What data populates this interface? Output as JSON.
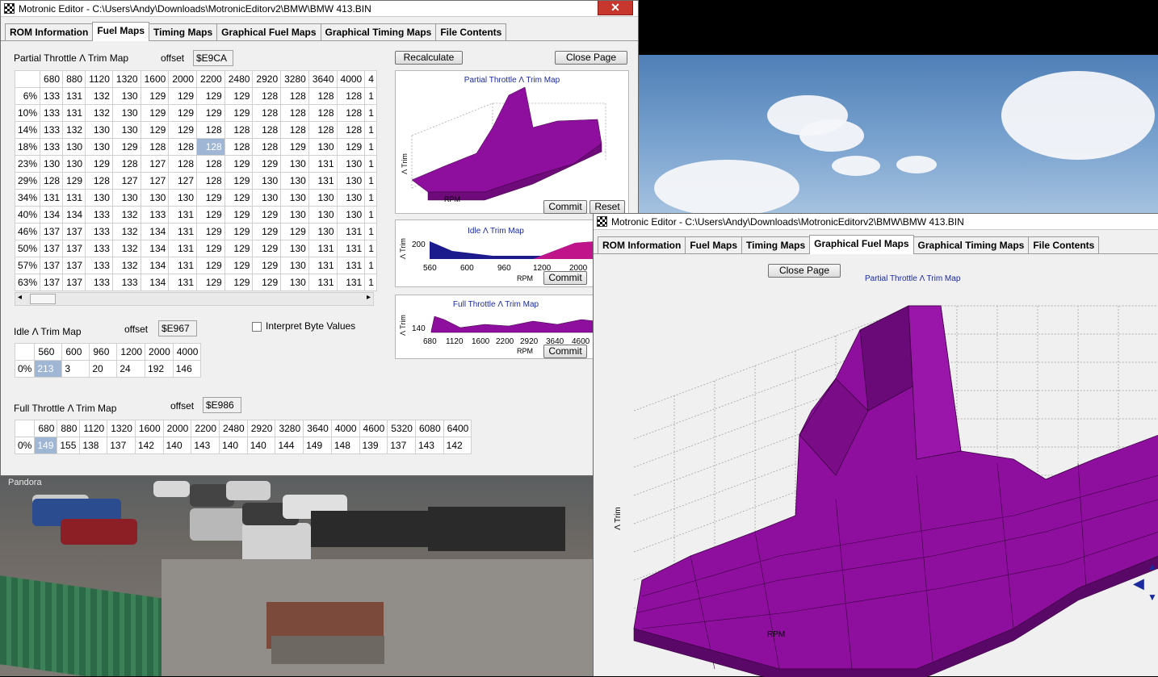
{
  "window1": {
    "title": "Motronic Editor - C:\\Users\\Andy\\Downloads\\MotronicEditorv2\\BMW\\BMW 413.BIN",
    "close_glyph": "✕",
    "tabs": [
      "ROM Information",
      "Fuel Maps",
      "Timing Maps",
      "Graphical Fuel Maps",
      "Graphical Timing Maps",
      "File Contents"
    ],
    "active_tab": "Fuel Maps",
    "partial": {
      "label": "Partial Throttle Λ Trim Map",
      "offset_label": "offset",
      "offset_value": "$E9CA",
      "columns": [
        "680",
        "880",
        "1120",
        "1320",
        "1600",
        "2000",
        "2200",
        "2480",
        "2920",
        "3280",
        "3640",
        "4000",
        "4"
      ],
      "rows": [
        {
          "label": "6%",
          "values": [
            "133",
            "131",
            "132",
            "130",
            "129",
            "129",
            "129",
            "129",
            "128",
            "128",
            "128",
            "128",
            "1"
          ]
        },
        {
          "label": "10%",
          "values": [
            "133",
            "131",
            "132",
            "130",
            "129",
            "129",
            "129",
            "129",
            "128",
            "128",
            "128",
            "128",
            "1"
          ]
        },
        {
          "label": "14%",
          "values": [
            "133",
            "132",
            "130",
            "130",
            "129",
            "129",
            "128",
            "128",
            "128",
            "128",
            "128",
            "128",
            "1"
          ]
        },
        {
          "label": "18%",
          "values": [
            "133",
            "130",
            "130",
            "129",
            "128",
            "128",
            "128",
            "128",
            "128",
            "129",
            "130",
            "129",
            "1"
          ]
        },
        {
          "label": "23%",
          "values": [
            "130",
            "130",
            "129",
            "128",
            "127",
            "128",
            "128",
            "129",
            "129",
            "130",
            "131",
            "130",
            "1"
          ]
        },
        {
          "label": "29%",
          "values": [
            "128",
            "129",
            "128",
            "127",
            "127",
            "127",
            "128",
            "129",
            "130",
            "130",
            "131",
            "130",
            "1"
          ]
        },
        {
          "label": "34%",
          "values": [
            "131",
            "131",
            "130",
            "130",
            "130",
            "130",
            "129",
            "129",
            "130",
            "130",
            "130",
            "130",
            "1"
          ]
        },
        {
          "label": "40%",
          "values": [
            "134",
            "134",
            "133",
            "132",
            "133",
            "131",
            "129",
            "129",
            "129",
            "130",
            "130",
            "130",
            "1"
          ]
        },
        {
          "label": "46%",
          "values": [
            "137",
            "137",
            "133",
            "132",
            "134",
            "131",
            "129",
            "129",
            "129",
            "129",
            "130",
            "131",
            "1"
          ]
        },
        {
          "label": "50%",
          "values": [
            "137",
            "137",
            "133",
            "132",
            "134",
            "131",
            "129",
            "129",
            "129",
            "130",
            "131",
            "131",
            "1"
          ]
        },
        {
          "label": "57%",
          "values": [
            "137",
            "137",
            "133",
            "132",
            "134",
            "131",
            "129",
            "129",
            "129",
            "130",
            "131",
            "131",
            "1"
          ]
        },
        {
          "label": "63%",
          "values": [
            "137",
            "137",
            "133",
            "133",
            "134",
            "131",
            "129",
            "129",
            "129",
            "130",
            "131",
            "131",
            "1"
          ]
        }
      ]
    },
    "idle": {
      "label": "Idle Λ Trim Map",
      "offset_label": "offset",
      "offset_value": "$E967",
      "columns": [
        "560",
        "600",
        "960",
        "1200",
        "2000",
        "4000"
      ],
      "row_label": "0%",
      "values": [
        "213",
        "3",
        "20",
        "24",
        "192",
        "146"
      ]
    },
    "interpret_label": "Interpret Byte Values",
    "full": {
      "label": "Full Throttle Λ Trim Map",
      "offset_label": "offset",
      "offset_value": "$E986",
      "columns": [
        "680",
        "880",
        "1120",
        "1320",
        "1600",
        "2000",
        "2200",
        "2480",
        "2920",
        "3280",
        "3640",
        "4000",
        "4600",
        "5320",
        "6080",
        "6400"
      ],
      "row_label": "0%",
      "values": [
        "149",
        "155",
        "138",
        "137",
        "142",
        "140",
        "143",
        "140",
        "140",
        "144",
        "149",
        "148",
        "139",
        "137",
        "143",
        "142"
      ]
    },
    "buttons": {
      "recalculate": "Recalculate",
      "close_page": "Close Page",
      "commit": "Commit",
      "reset": "Reset"
    },
    "chart1": {
      "title": "Partial Throttle Λ Trim Map",
      "ylabel": "Λ Trim",
      "xlabel": "RPM"
    },
    "chart2": {
      "title": "Idle Λ Trim Map",
      "ylabel": "Λ Trim",
      "xlabel": "RPM",
      "y_tick": "200",
      "x_ticks": [
        "560",
        "600",
        "960",
        "1200",
        "2000"
      ]
    },
    "chart3": {
      "title": "Full Throttle Λ Trim Map",
      "ylabel": "Λ Trim",
      "xlabel": "RPM",
      "y_tick": "140",
      "x_ticks": [
        "680",
        "1120",
        "1600",
        "2200",
        "2920",
        "3640",
        "4600"
      ]
    }
  },
  "window2": {
    "title": "Motronic Editor - C:\\Users\\Andy\\Downloads\\MotronicEditorv2\\BMW\\BMW 413.BIN",
    "tabs": [
      "ROM Information",
      "Fuel Maps",
      "Timing Maps",
      "Graphical Fuel Maps",
      "Graphical Timing Maps",
      "File Contents"
    ],
    "active_tab": "Graphical Fuel Maps",
    "close_page": "Close Page",
    "chart_title": "Partial Throttle Λ Trim Map",
    "ylabel": "Λ Trim",
    "xlabel": "RPM"
  },
  "desktop": {
    "photo_label": "Pandora"
  },
  "colors": {
    "surface_fill": "#8e0f9e",
    "surface_edge": "#3a0040",
    "chart_title": "#1b2a9f",
    "selected_cell": "#9fb7d4"
  }
}
